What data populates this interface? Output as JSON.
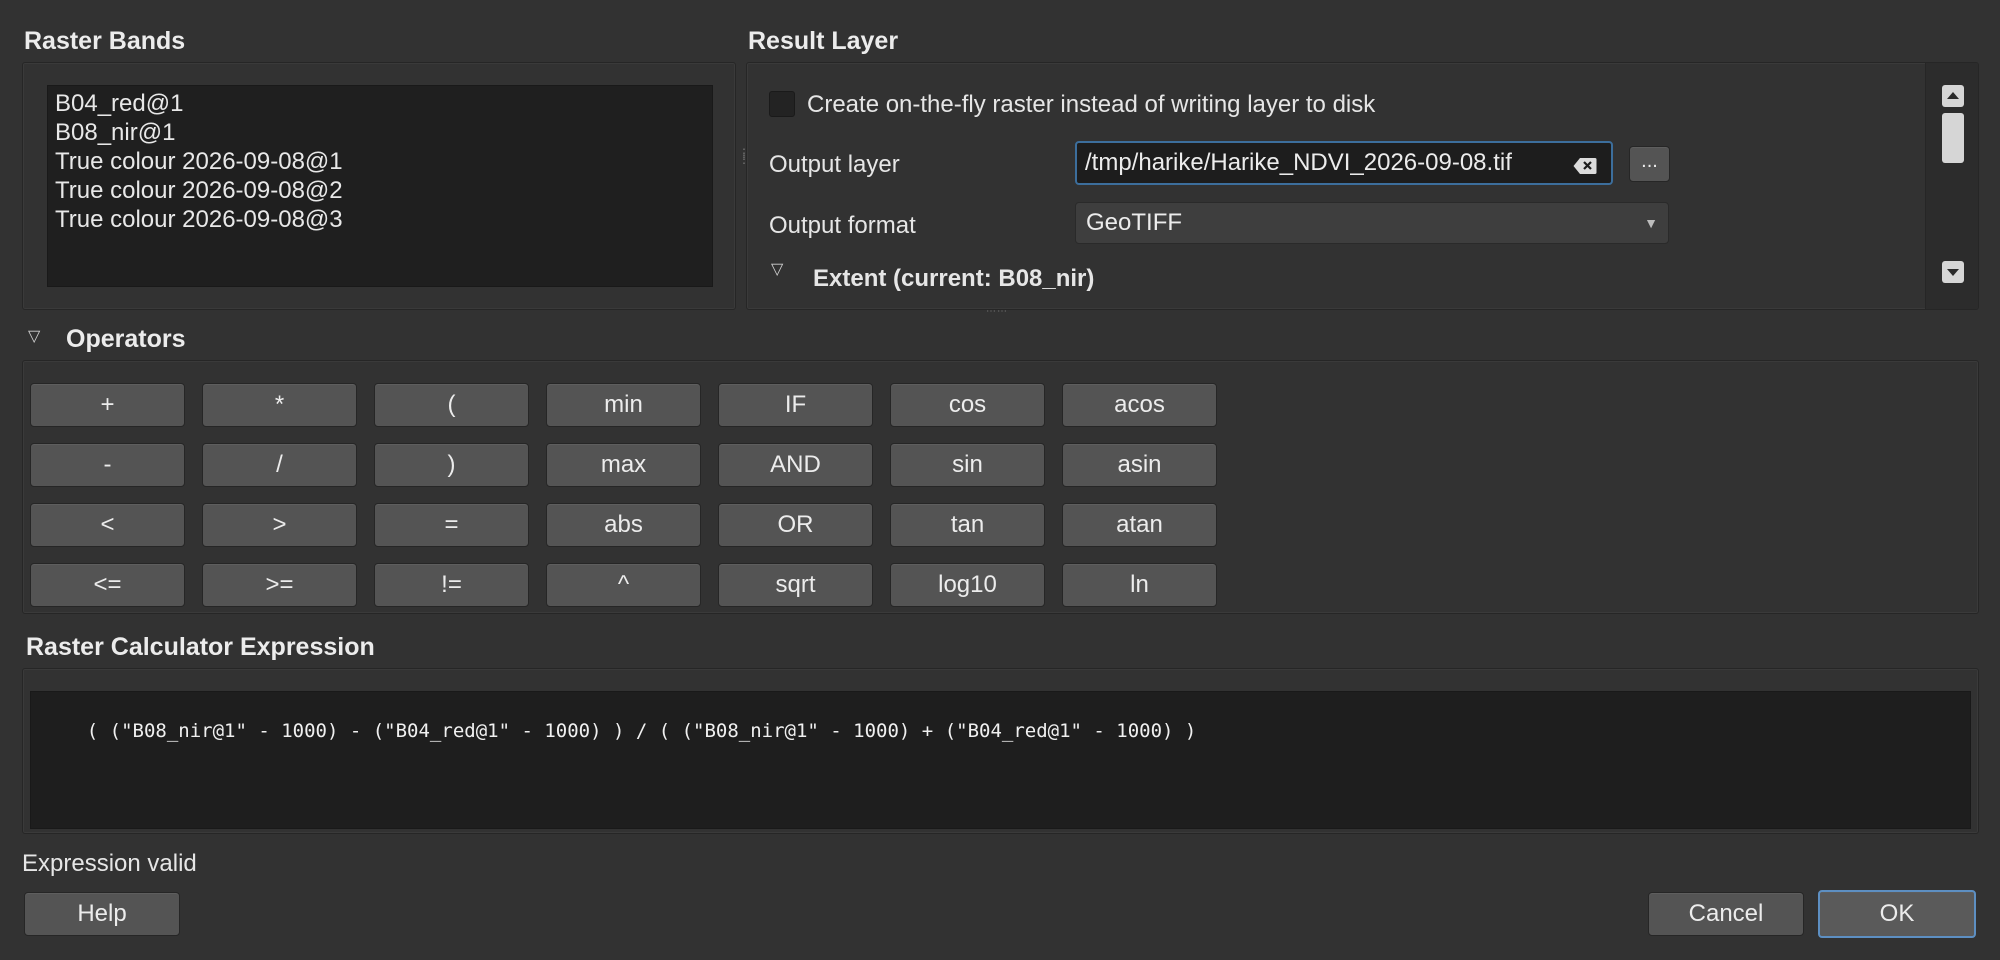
{
  "raster_bands": {
    "title": "Raster Bands",
    "items": [
      "B04_red@1",
      "B08_nir@1",
      "True colour 2026-09-08@1",
      "True colour 2026-09-08@2",
      "True colour 2026-09-08@3"
    ]
  },
  "result_layer": {
    "title": "Result Layer",
    "on_the_fly_label": "Create on-the-fly raster instead of writing layer to disk",
    "on_the_fly_checked": false,
    "output_layer_label": "Output layer",
    "output_layer_value": "/tmp/harike/Harike_NDVI_2026-09-08.tif",
    "browse_label": "...",
    "output_format_label": "Output format",
    "output_format_value": "GeoTIFF",
    "extent_label": "Extent (current: B08_nir)"
  },
  "operators": {
    "title": "Operators",
    "buttons": [
      "+",
      "*",
      "(",
      "min",
      "IF",
      "cos",
      "acos",
      "-",
      "/",
      ")",
      "max",
      "AND",
      "sin",
      "asin",
      "<",
      ">",
      "=",
      "abs",
      "OR",
      "tan",
      "atan",
      "<=",
      ">=",
      "!=",
      "^",
      "sqrt",
      "log10",
      "ln"
    ]
  },
  "expression": {
    "title": "Raster Calculator Expression",
    "value": "( (\"B08_nir@1\" - 1000) - (\"B04_red@1\" - 1000) ) / ( (\"B08_nir@1\" - 1000) + (\"B04_red@1\" - 1000) )",
    "status": "Expression valid"
  },
  "footer": {
    "help_label": "Help",
    "cancel_label": "Cancel",
    "ok_label": "OK"
  },
  "colors": {
    "background": "#323232",
    "field_background": "#1e1e1e",
    "button": "#545454",
    "focus_border": "#3c6e9c",
    "ok_border": "#5d8fc2"
  }
}
